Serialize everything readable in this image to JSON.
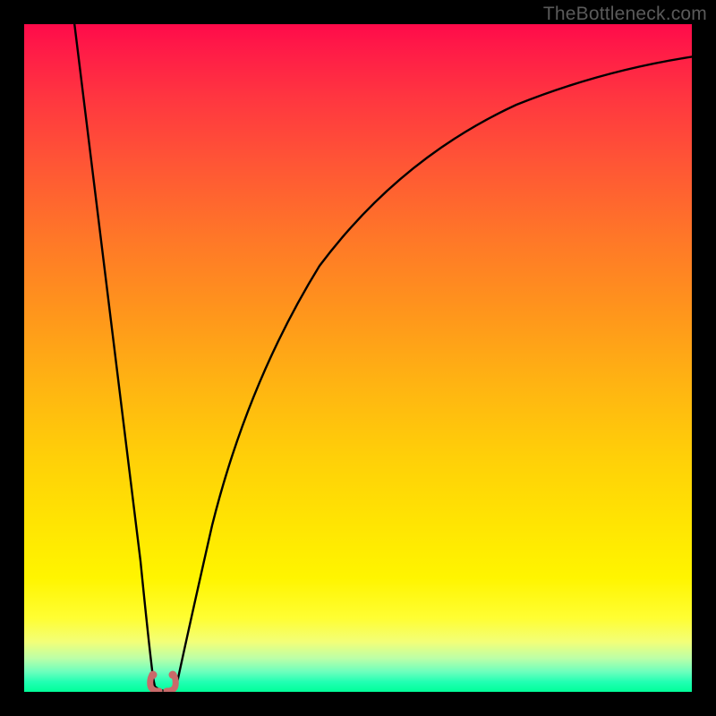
{
  "watermark": "TheBottleneck.com",
  "chart_data": {
    "type": "line",
    "title": "",
    "xlabel": "",
    "ylabel": "",
    "xlim": [
      0,
      100
    ],
    "ylim": [
      0,
      100
    ],
    "background_gradient": {
      "top_color": "#ff0a4a",
      "bottom_color": "#00ff99",
      "note": "red at top fading through orange and yellow to green at bottom; lower y = better"
    },
    "series": [
      {
        "name": "bottleneck-curve",
        "x": [
          0,
          4,
          8,
          12,
          16,
          18,
          19,
          20,
          21,
          22,
          24,
          28,
          34,
          42,
          52,
          64,
          78,
          92,
          100
        ],
        "values": [
          100,
          80,
          60,
          40,
          20,
          6,
          1,
          0,
          0,
          1,
          6,
          22,
          42,
          58,
          70,
          79,
          85,
          89,
          91
        ],
        "note": "approximate V-shaped curve; minimum (0) occurs near x≈20–21"
      }
    ],
    "markers": [
      {
        "name": "min-marker-left",
        "x": 19.2,
        "y": 1.0,
        "color": "#cc6666"
      },
      {
        "name": "min-marker-right",
        "x": 21.3,
        "y": 1.0,
        "color": "#cc6666"
      }
    ],
    "min_region": {
      "x_start": 19,
      "x_end": 22,
      "y": 0
    }
  }
}
